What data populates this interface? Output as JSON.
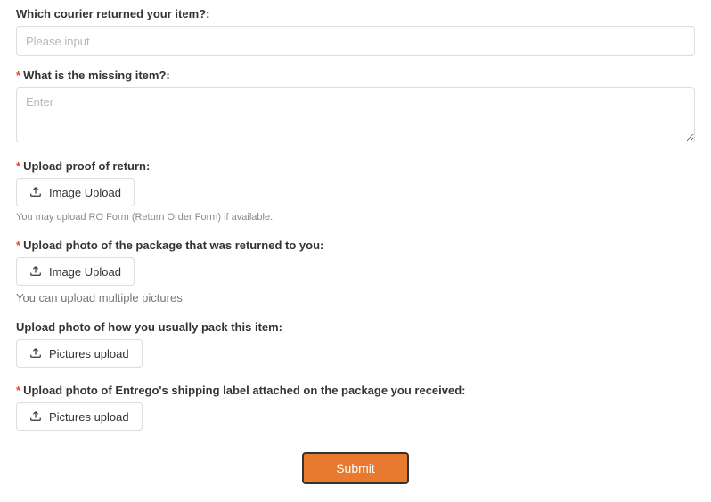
{
  "fields": {
    "courier": {
      "label": "Which courier returned your item?:",
      "placeholder": "Please input"
    },
    "missing": {
      "label": "What is the missing item?:",
      "placeholder": "Enter"
    },
    "proof": {
      "label": "Upload proof of return:",
      "button": "Image Upload",
      "hint": "You may upload RO Form (Return Order Form) if available."
    },
    "package": {
      "label": "Upload photo of the package that was returned to you:",
      "button": "Image Upload",
      "hint": "You can upload multiple pictures"
    },
    "pack": {
      "label": "Upload photo of how you usually pack this item:",
      "button": "Pictures upload"
    },
    "shipping": {
      "label": "Upload photo of Entrego's shipping label attached on the package you received:",
      "button": "Pictures upload"
    }
  },
  "submit": "Submit"
}
